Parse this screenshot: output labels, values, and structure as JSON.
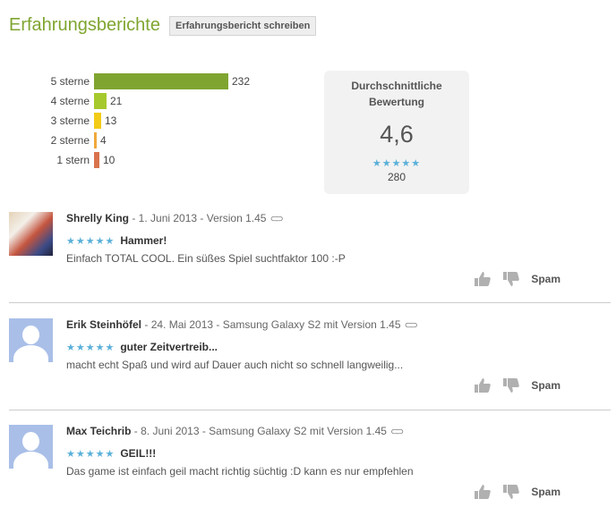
{
  "header": {
    "title": "Erfahrungsberichte",
    "write_button": "Erfahrungsbericht schreiben"
  },
  "histogram": [
    {
      "label": "5 sterne",
      "count": "232",
      "value": 232,
      "color": "#7fa530"
    },
    {
      "label": "4 sterne",
      "count": "21",
      "value": 21,
      "color": "#a6c92d"
    },
    {
      "label": "3 sterne",
      "count": "13",
      "value": 13,
      "color": "#f2cc17"
    },
    {
      "label": "2 sterne",
      "count": "4",
      "value": 4,
      "color": "#f0a83c"
    },
    {
      "label": "1 stern",
      "count": "10",
      "value": 10,
      "color": "#d9734d"
    }
  ],
  "average": {
    "label": "Durchschnittliche Bewertung",
    "value": "4,6",
    "stars": "★★★★★",
    "count": "280"
  },
  "reviews": [
    {
      "author": "Shrelly King",
      "meta": " - 1. Juni 2013 - Version 1.45",
      "stars": "★★★★★",
      "title": "Hammer!",
      "body": "Einfach TOTAL COOL. Ein süßes Spiel suchtfaktor 100 :-P",
      "spam": "Spam",
      "avatar": "anime"
    },
    {
      "author": "Erik Steinhöfel",
      "meta": " - 24. Mai 2013 - Samsung Galaxy S2 mit Version 1.45",
      "stars": "★★★★★",
      "title": "guter Zeitvertreib...",
      "body": "macht echt Spaß und wird auf Dauer auch nicht so schnell langweilig...",
      "spam": "Spam",
      "avatar": "default"
    },
    {
      "author": "Max Teichrib",
      "meta": " - 8. Juni 2013 - Samsung Galaxy S2 mit Version 1.45",
      "stars": "★★★★★",
      "title": "GEIL!!!",
      "body": "Das game ist einfach geil macht richtig süchtig :D kann es nur empfehlen",
      "spam": "Spam",
      "avatar": "default"
    }
  ],
  "colors": {
    "accent_green": "#7fa530",
    "star_blue": "#5ab0d9"
  }
}
